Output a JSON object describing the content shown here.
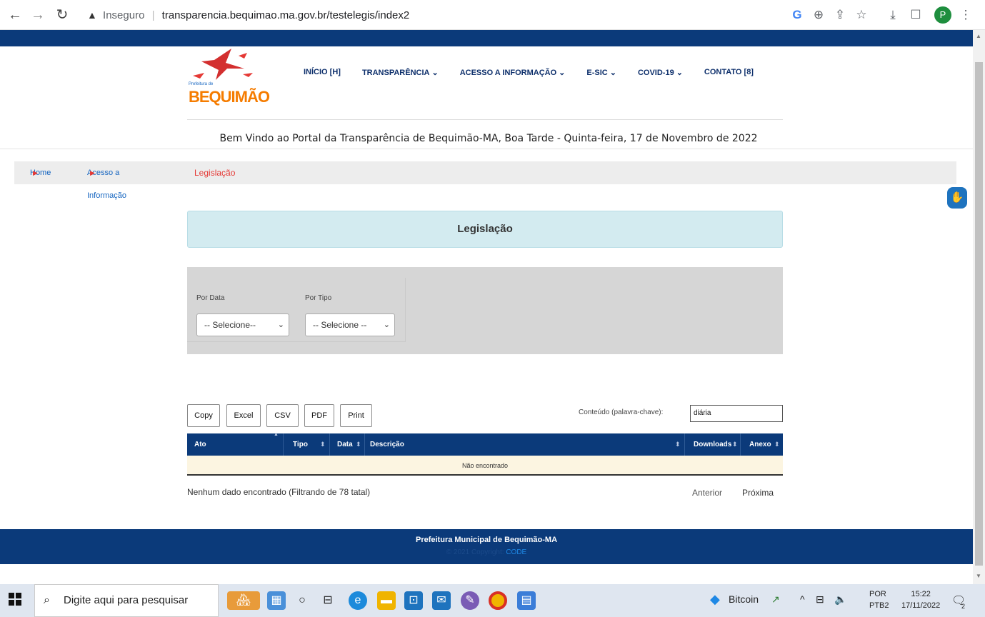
{
  "browser": {
    "insecure_label": "Inseguro",
    "url": "transparencia.bequimao.ma.gov.br/testelegis/index2",
    "profile_initial": "P",
    "icons": [
      "back-icon",
      "forward-icon",
      "reload-icon",
      "warning-icon",
      "google-icon",
      "zoom-icon",
      "share-icon",
      "bookmark-star-icon",
      "download-icon",
      "tab-icon",
      "menu-icon"
    ]
  },
  "header": {
    "logo_small_text": "Prefeitura de",
    "logo_name": "BEQUIMÃO",
    "nav": [
      {
        "label": "INÍCIO [H]",
        "has_dropdown": false
      },
      {
        "label": "TRANSPARÊNCIA",
        "has_dropdown": true
      },
      {
        "label": "ACESSO A INFORMAÇÃO",
        "has_dropdown": true
      },
      {
        "label": "E-SIC",
        "has_dropdown": true
      },
      {
        "label": "COVID-19",
        "has_dropdown": true
      },
      {
        "label": "CONTATO [8]",
        "has_dropdown": false
      }
    ],
    "welcome": "Bem Vindo ao Portal da Transparência de Bequimão-MA, Boa Tarde - Quinta-feira, 17 de Novembro de 2022"
  },
  "breadcrumb": {
    "home": "Home",
    "access": "Acesso a Informação",
    "current": "Legislação"
  },
  "page": {
    "title": "Legislação"
  },
  "filters": {
    "date_label": "Por Data",
    "date_value": "-- Selecione--",
    "type_label": "Por Tipo",
    "type_value": "-- Selecione --"
  },
  "export_buttons": [
    "Copy",
    "Excel",
    "CSV",
    "PDF",
    "Print"
  ],
  "search": {
    "label": "Conteúdo (palavra-chave):",
    "value": "diária"
  },
  "table": {
    "columns": [
      "Ato",
      "Tipo",
      "Data",
      "Descrição",
      "Downloads",
      "Anexo"
    ],
    "empty_message": "Não encontrado"
  },
  "pagination": {
    "info": "Nenhum dado encontrado (Filtrando de 78 tatal)",
    "prev": "Anterior",
    "next": "Próxima"
  },
  "footer": {
    "title": "Prefeitura Municipal de Bequimão-MA",
    "copyright": "© 2021 Copyright:",
    "brand": "CODE"
  },
  "taskbar": {
    "search_placeholder": "Digite aqui para pesquisar",
    "bitcoin": "Bitcoin",
    "lang_top": "POR",
    "lang_bottom": "PTB2",
    "time": "15:22",
    "date": "17/11/2022",
    "notifications": "2"
  },
  "colors": {
    "navy": "#0b3a7a",
    "title_bg": "#d3ebf0",
    "filter_bg": "#d6d6d6",
    "empty_row_bg": "#fcf5e1",
    "link_blue": "#1565c0",
    "breadcrumb_red": "#e53935"
  }
}
